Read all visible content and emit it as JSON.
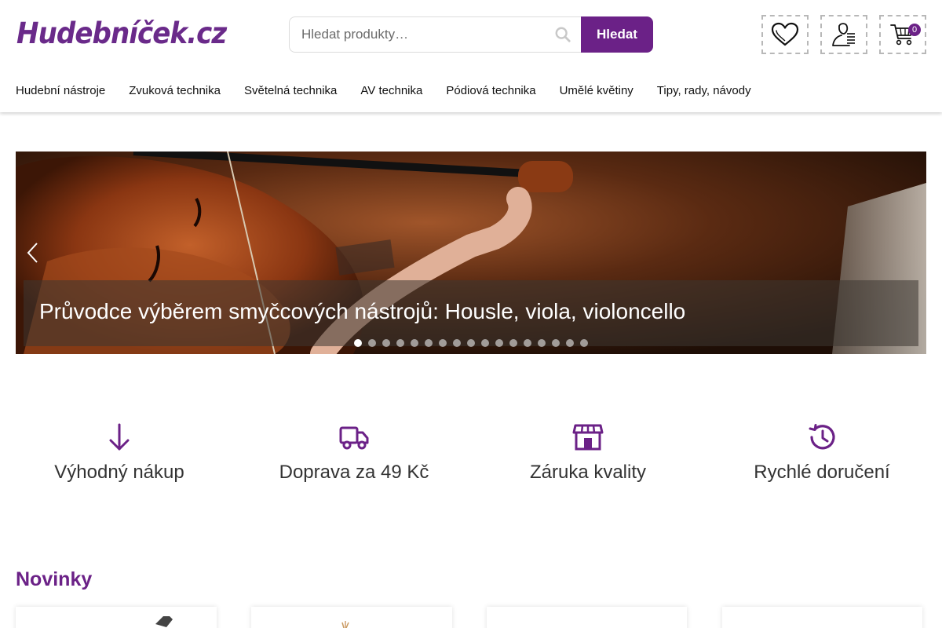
{
  "header": {
    "logo": "Hudebníček.cz",
    "search": {
      "placeholder": "Hledat produkty…",
      "button_label": "Hledat"
    },
    "cart_count": "0",
    "icons": {
      "wishlist": "heart-icon",
      "account": "user-icon",
      "cart": "cart-icon"
    }
  },
  "nav": {
    "items": [
      {
        "label": "Hudební nástroje"
      },
      {
        "label": "Zvuková technika"
      },
      {
        "label": "Světelná technika"
      },
      {
        "label": "AV technika"
      },
      {
        "label": "Pódiová technika"
      },
      {
        "label": "Umělé květiny"
      },
      {
        "label": "Tipy, rady, návody"
      }
    ]
  },
  "hero": {
    "caption": "Průvodce výběrem smyčcových nástrojů: Housle, viola, violoncello",
    "slide_count": 17,
    "active_slide": 1
  },
  "features": [
    {
      "label": "Výhodný nákup",
      "icon": "arrow-down-icon"
    },
    {
      "label": "Doprava za 49 Kč",
      "icon": "truck-icon"
    },
    {
      "label": "Záruka kvality",
      "icon": "store-icon"
    },
    {
      "label": "Rychlé doručení",
      "icon": "history-icon"
    }
  ],
  "news": {
    "title": "Novinky"
  },
  "colors": {
    "brand": "#6b2187",
    "logo": "#6a2a8a"
  }
}
